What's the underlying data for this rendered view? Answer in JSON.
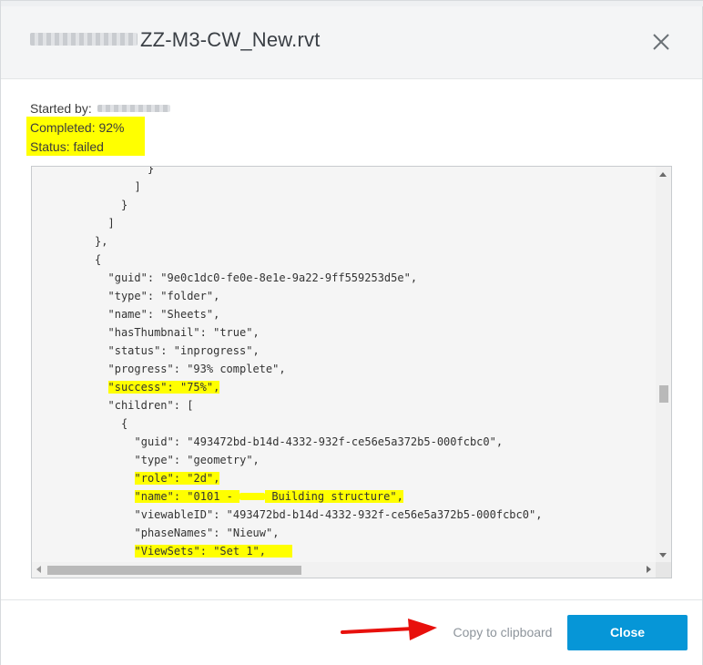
{
  "dialog": {
    "title_suffix": "ZZ-M3-CW_New.rvt",
    "close_icon": "close-icon"
  },
  "info": {
    "started_by_label": "Started by:",
    "completed": "Completed: 92%",
    "status": "Status: failed"
  },
  "log": {
    "lines": [
      {
        "indent": 16,
        "parts": [
          {
            "t": "}"
          }
        ]
      },
      {
        "indent": 14,
        "parts": [
          {
            "t": "]"
          }
        ]
      },
      {
        "indent": 12,
        "parts": [
          {
            "t": "}"
          }
        ]
      },
      {
        "indent": 10,
        "parts": [
          {
            "t": "]"
          }
        ]
      },
      {
        "indent": 8,
        "parts": [
          {
            "t": "},"
          }
        ]
      },
      {
        "indent": 8,
        "parts": [
          {
            "t": "{"
          }
        ]
      },
      {
        "indent": 10,
        "parts": [
          {
            "t": "\"guid\": \"9e0c1dc0-fe0e-8e1e-9a22-9ff559253d5e\","
          }
        ]
      },
      {
        "indent": 10,
        "parts": [
          {
            "t": "\"type\": \"folder\","
          }
        ]
      },
      {
        "indent": 10,
        "parts": [
          {
            "t": "\"name\": \"Sheets\","
          }
        ]
      },
      {
        "indent": 10,
        "parts": [
          {
            "t": "\"hasThumbnail\": \"true\","
          }
        ]
      },
      {
        "indent": 10,
        "parts": [
          {
            "t": "\"status\": \"inprogress\","
          }
        ]
      },
      {
        "indent": 10,
        "parts": [
          {
            "t": "\"progress\": \"93% complete\","
          }
        ]
      },
      {
        "indent": 10,
        "parts": [
          {
            "t": "\"success\": \"75%\",",
            "h": true
          }
        ]
      },
      {
        "indent": 10,
        "parts": [
          {
            "t": "\"children\": ["
          }
        ]
      },
      {
        "indent": 12,
        "parts": [
          {
            "t": "{"
          }
        ]
      },
      {
        "indent": 14,
        "parts": [
          {
            "t": "\"guid\": \"493472bd-b14d-4332-932f-ce56e5a372b5-000fcbc0\","
          }
        ]
      },
      {
        "indent": 14,
        "parts": [
          {
            "t": "\"type\": \"geometry\","
          }
        ]
      },
      {
        "indent": 14,
        "parts": [
          {
            "t": "\"role\": \"2d\",",
            "h": true
          }
        ]
      },
      {
        "indent": 14,
        "parts": [
          {
            "t": "\"name\": \"0101 - ",
            "h": true
          },
          {
            "r": true,
            "h": true
          },
          {
            "t": " Building structure\",",
            "h": true
          }
        ]
      },
      {
        "indent": 14,
        "parts": [
          {
            "t": "\"viewableID\": \"493472bd-b14d-4332-932f-ce56e5a372b5-000fcbc0\","
          }
        ]
      },
      {
        "indent": 14,
        "parts": [
          {
            "t": "\"phaseNames\": \"Nieuw\","
          }
        ]
      },
      {
        "indent": 14,
        "parts": [
          {
            "t": "\"ViewSets\": \"Set 1\",    ",
            "h": true
          }
        ]
      }
    ]
  },
  "footer": {
    "copy_label": "Copy to clipboard",
    "close_label": "Close"
  },
  "colors": {
    "primary": "#0696d7",
    "highlight": "#ffff00",
    "arrow": "#e8100c"
  }
}
